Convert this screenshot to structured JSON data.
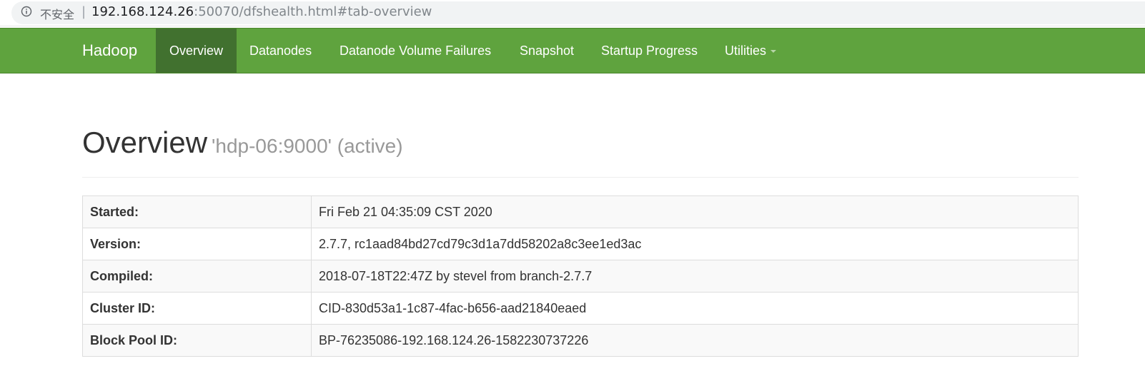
{
  "browser": {
    "security_label": "不安全",
    "separator": "|",
    "url_host": "192.168.124.26",
    "url_rest": ":50070/dfshealth.html#tab-overview",
    "icon": "info-icon"
  },
  "navbar": {
    "brand": "Hadoop",
    "items": [
      {
        "label": "Overview",
        "active": true
      },
      {
        "label": "Datanodes"
      },
      {
        "label": "Datanode Volume Failures"
      },
      {
        "label": "Snapshot"
      },
      {
        "label": "Startup Progress"
      },
      {
        "label": "Utilities",
        "dropdown": true
      }
    ],
    "color": "#5fa33e",
    "active_color": "#41712f"
  },
  "header": {
    "title": "Overview",
    "subtitle": "'hdp-06:9000' (active)"
  },
  "overview_table": [
    {
      "label": "Started:",
      "value": "Fri Feb 21 04:35:09 CST 2020"
    },
    {
      "label": "Version:",
      "value": "2.7.7, rc1aad84bd27cd79c3d1a7dd58202a8c3ee1ed3ac"
    },
    {
      "label": "Compiled:",
      "value": "2018-07-18T22:47Z by stevel from branch-2.7.7"
    },
    {
      "label": "Cluster ID:",
      "value": "CID-830d53a1-1c87-4fac-b656-aad21840eaed"
    },
    {
      "label": "Block Pool ID:",
      "value": "BP-76235086-192.168.124.26-1582230737226"
    }
  ]
}
